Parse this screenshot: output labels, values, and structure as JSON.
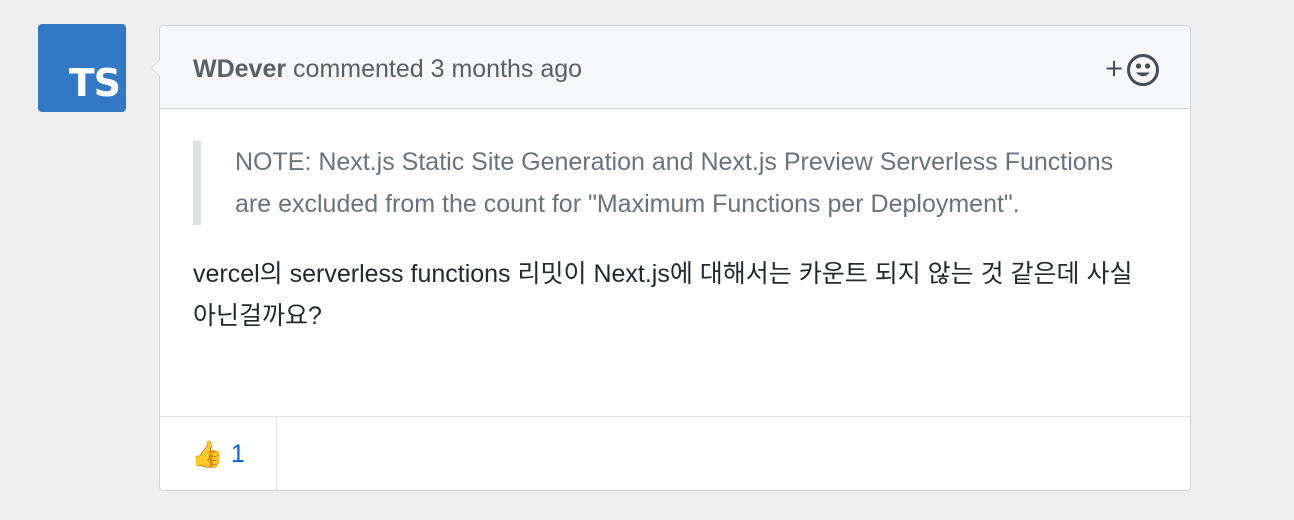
{
  "avatar": {
    "text": "TS",
    "color": "#3178c6"
  },
  "comment": {
    "author": "WDever",
    "action_text": " commented 3 months ago",
    "add_reaction_plus": "+",
    "add_reaction_icon": "smiley-icon",
    "blockquote": "NOTE: Next.js Static Site Generation and Next.js Preview Serverless Functions are excluded from the count for \"Maximum Functions per Deployment\".",
    "body": "vercel의 serverless functions 리밋이 Next.js에 대해서는 카운트 되지 않는 것 같은데 사실 아닌걸까요?"
  },
  "reactions": [
    {
      "emoji": "👍",
      "icon": "thumbs-up-icon",
      "count": "1"
    }
  ],
  "colors": {
    "background": "#efefef",
    "header_bg": "#f6f8fa",
    "border": "#d1d5da",
    "link": "#0366d6",
    "quote_text": "#6a737d",
    "body_text": "#24292e"
  }
}
